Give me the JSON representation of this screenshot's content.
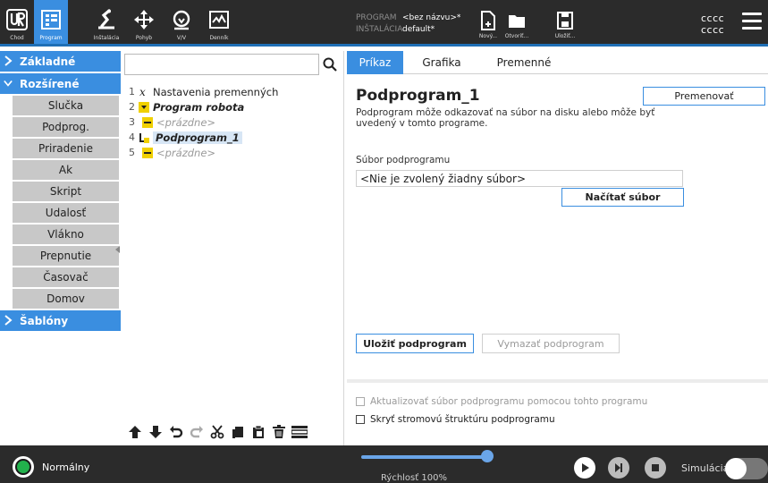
{
  "header": {
    "nav": [
      {
        "label": "Chod",
        "icon": "ur-logo-icon"
      },
      {
        "label": "Program",
        "icon": "program-icon",
        "active": true
      },
      {
        "label": "Inštalácia",
        "icon": "installation-icon"
      },
      {
        "label": "Pohyb",
        "icon": "move-icon"
      },
      {
        "label": "V/V",
        "icon": "io-icon"
      },
      {
        "label": "Denník",
        "icon": "log-icon"
      }
    ],
    "program_key": "PROGRAM",
    "program_value": "<bez názvu>*",
    "installation_key": "INŠTALÁCIA",
    "installation_value": "default*",
    "file_buttons": [
      {
        "label": "Nový...",
        "icon": "new-file-icon"
      },
      {
        "label": "Otvoriť...",
        "icon": "open-folder-icon"
      },
      {
        "label": "Uložiť...",
        "icon": "save-icon"
      }
    ],
    "user_line1": "cccc",
    "user_line2": "cccc"
  },
  "categories": {
    "basic": "Základné",
    "advanced": "Rozšírené",
    "advanced_items": [
      "Slučka",
      "Podprog.",
      "Priradenie",
      "Ak",
      "Skript",
      "Udalosť",
      "Vlákno",
      "Prepnutie",
      "Časovač",
      "Domov"
    ],
    "templates": "Šablóny"
  },
  "tree": {
    "search_placeholder": "",
    "rows": [
      {
        "num": "1",
        "label": "Nastavenia premenných",
        "icon": "variables-icon"
      },
      {
        "num": "2",
        "label": "Program robota",
        "icon": "robot-program-icon"
      },
      {
        "num": "3",
        "label": "<prázdne>",
        "icon": "empty-node-icon"
      },
      {
        "num": "4",
        "label": "Podprogram_1",
        "icon": "subprogram-icon"
      },
      {
        "num": "5",
        "label": "<prázdne>",
        "icon": "empty-node-icon"
      }
    ],
    "toolbar": [
      "move-up-icon",
      "move-down-icon",
      "undo-icon",
      "redo-icon",
      "cut-icon",
      "copy-icon",
      "paste-icon",
      "delete-icon",
      "suppress-icon"
    ]
  },
  "tabs": [
    "Príkaz",
    "Grafika",
    "Premenné"
  ],
  "command": {
    "title": "Podprogram_1",
    "rename": "Premenovať",
    "description": "Podprogram môže odkazovať na súbor na disku alebo môže byť uvedený v tomto programe.",
    "file_label": "Súbor podprogramu",
    "file_value": "<Nie je zvolený žiadny súbor>",
    "load": "Načítať súbor",
    "save": "Uložiť podprogram",
    "clear": "Vymazať podprogram",
    "update_check": "Aktualizovať súbor podprogramu pomocou tohto programu",
    "hide_check": "Skryť stromovú štruktúru podprogramu"
  },
  "footer": {
    "status": "Normálny",
    "status_color": "#22b14c",
    "speed": "Rýchlosť 100%",
    "speed_value": 100,
    "simulation": "Simulácia"
  },
  "colors": {
    "accent": "#3a8ee0",
    "header_bg": "#2b2b2b"
  }
}
